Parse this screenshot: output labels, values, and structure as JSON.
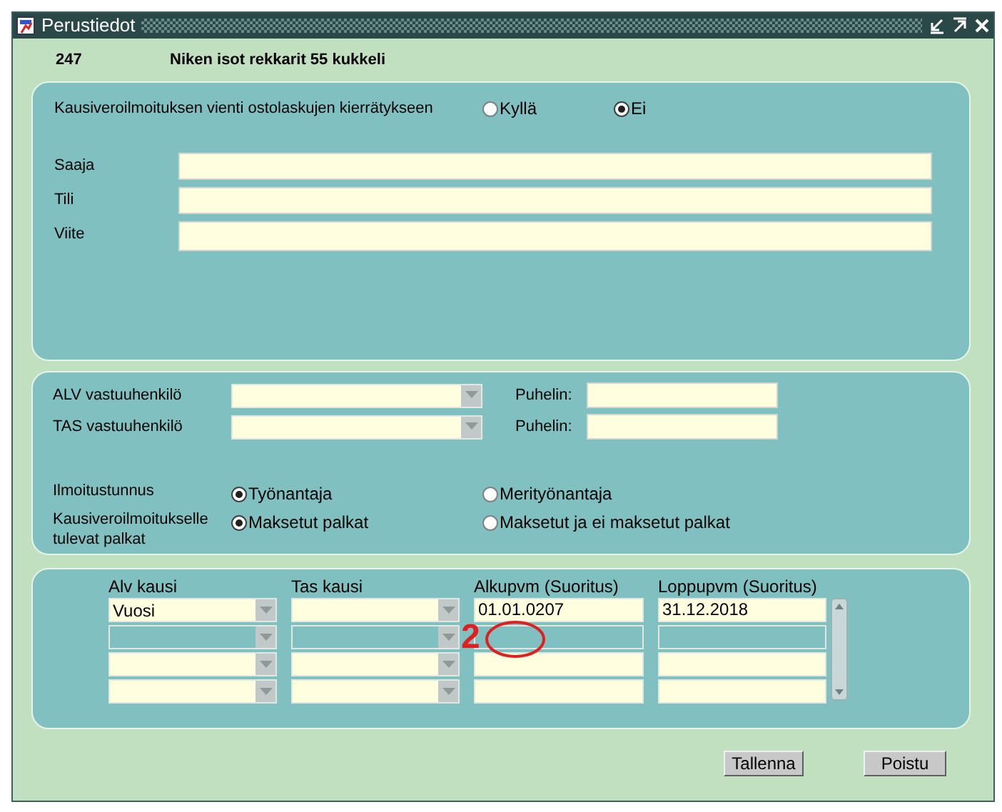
{
  "window": {
    "title": "Perustiedot"
  },
  "header": {
    "number": "247",
    "name": "Niken isot rekkarit 55 kukkeli"
  },
  "export_setting": {
    "label": "Kausiveroilmoituksen vienti ostolaskujen kierrätykseen",
    "options": [
      {
        "label": "Kyllä",
        "selected": false
      },
      {
        "label": "Ei",
        "selected": true
      }
    ]
  },
  "payee_fields": [
    {
      "label": "Saaja"
    },
    {
      "label": "Tili"
    },
    {
      "label": "Viite"
    }
  ],
  "responsibles": [
    {
      "label": "ALV vastuuhenkilö",
      "phone_label": "Puhelin:"
    },
    {
      "label": "TAS vastuuhenkilö",
      "phone_label": "Puhelin:"
    }
  ],
  "radio_groups": [
    {
      "label": "Ilmoitustunnus",
      "options": [
        {
          "label": "Työnantaja",
          "selected": true
        },
        {
          "label": "Merityönantaja",
          "selected": false
        }
      ]
    },
    {
      "label": "Kausiveroilmoitukselle tulevat palkat",
      "options": [
        {
          "label": "Maksetut palkat",
          "selected": true
        },
        {
          "label": "Maksetut ja ei maksetut palkat",
          "selected": false
        }
      ]
    }
  ],
  "period_table": {
    "columns": [
      {
        "label": "Alv kausi",
        "kind": "combo"
      },
      {
        "label": "Tas kausi",
        "kind": "combo"
      },
      {
        "label": "Alkupvm (Suoritus)",
        "kind": "text"
      },
      {
        "label": "Loppupvm (Suoritus)",
        "kind": "text"
      }
    ],
    "rows": [
      {
        "selected": false,
        "cells": [
          {
            "value": "Vuosi"
          },
          {},
          {
            "value": "01.01.0207"
          },
          {
            "value": "31.12.2018"
          }
        ]
      },
      {
        "selected": true,
        "cells": [
          {},
          {},
          {},
          {}
        ]
      },
      {
        "selected": false,
        "cells": [
          {},
          {},
          {},
          {}
        ]
      },
      {
        "selected": false,
        "cells": [
          {},
          {},
          {},
          {}
        ]
      }
    ]
  },
  "annotation": {
    "text": "2"
  },
  "buttons": [
    {
      "label": "Tallenna"
    },
    {
      "label": "Poistu"
    }
  ]
}
